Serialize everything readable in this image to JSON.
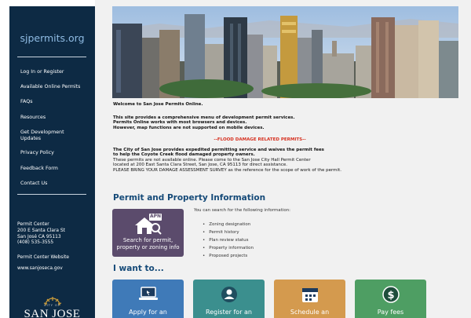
{
  "sidebar": {
    "brand": "sjpermits.org",
    "nav": [
      {
        "label": "Log In or Register"
      },
      {
        "label": "Available Online Permits"
      },
      {
        "label": "FAQs"
      },
      {
        "label": "Resources"
      },
      {
        "label": "Get Development Updates"
      },
      {
        "label": "Privacy Policy"
      },
      {
        "label": "Feedback Form"
      },
      {
        "label": "Contact Us"
      }
    ],
    "permit_center": {
      "title": "Permit Center",
      "address1": "200 E Santa Clara St",
      "address2": "San José CA 95113",
      "phone": "(408) 535-3555",
      "website_label": "Permit Center Website",
      "website": "www.sanjoseca.gov"
    },
    "seal_city_of": "CITY OF",
    "seal_name": "SAN JOSE"
  },
  "main": {
    "welcome": "Welcome to San Jose Permits Online.",
    "p1_line1": "This site provides a comprehensive menu of development permit services.",
    "p1_line2": "Permits Online works with most browsers and devices.",
    "p1_line3": "However, map functions are not supported on mobile devices.",
    "flood_notice": "--FLOOD DAMAGE RELATED PERMITS--",
    "flood_line1": "The City of San Jose provides expedited permitting service and waives the permit fees",
    "flood_line2": "to help the Coyote Creek flood damaged property owners.",
    "flood_line3": "These permits are not available online. Please come to the San Jose City Hall Permit Center",
    "flood_line4": "located at 200 East Santa Clara Street, San Jose, CA 95113 for direct assistance.",
    "flood_line5": "PLEASE BRING YOUR DAMAGE ASSESSMENT SURVEY as the reference for the scope of work of the permit.",
    "permit_section_title": "Permit and Property Information",
    "search_button": {
      "badge": "APN",
      "line1": "Search for permit,",
      "line2": "property or zoning info"
    },
    "search_info": "You can search for the following information:",
    "search_items": [
      "Zoning designation",
      "Permit history",
      "Plan review status",
      "Property information",
      "Proposed projects"
    ],
    "i_want_title": "I want to...",
    "tiles": [
      {
        "label": "Apply for an",
        "color": "#3f7ab8"
      },
      {
        "label": "Register for an",
        "color": "#3b8f8e"
      },
      {
        "label": "Schedule an",
        "color": "#d49a4e"
      },
      {
        "label": "Pay fees",
        "color": "#4e9e63"
      }
    ]
  }
}
